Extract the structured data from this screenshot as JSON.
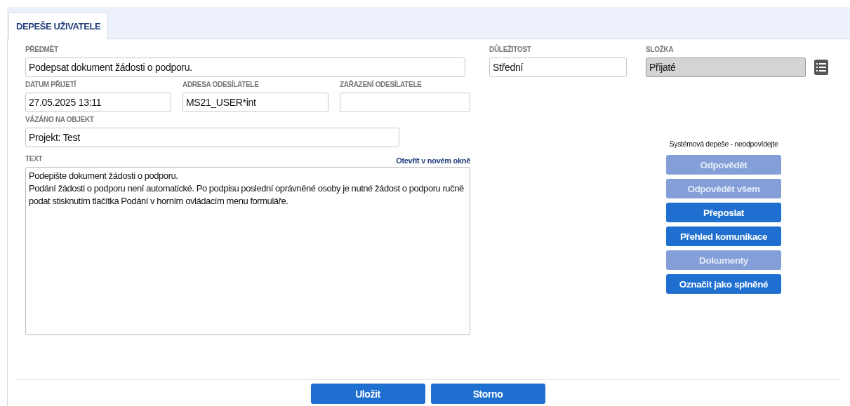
{
  "tab": {
    "label": "DEPEŠE UŽIVATELE",
    "selected": true
  },
  "subject": {
    "label": "PŘEDMĚT",
    "value": "Podepsat dokument žádosti o podporu."
  },
  "importance": {
    "label": "DŮLEŽITOST",
    "value": "Střední"
  },
  "folder": {
    "label": "SLOŽKA",
    "value": "Přijaté",
    "disabled": true
  },
  "received": {
    "label": "DATUM PŘIJETÍ",
    "value": "27.05.2025 13:11"
  },
  "sender_address": {
    "label": "ADRESA ODESÍLATELE",
    "value": "MS21_USER*int"
  },
  "sender_category": {
    "label": "ZAŘAZENÍ ODESÍLATELE"
  },
  "linked_object": {
    "label": "VÁZÁNO NA OBJEKT",
    "value": "Projekt: Test"
  },
  "text": {
    "label": "TEXT",
    "link": "Otevřít v novém okně",
    "lines": [
      "Podepište dokument žádosti o podporu.",
      "Podání žádosti o podporu není automatické. Po podpisu poslední oprávněné osoby je nutné žádost o podporu ručně podat stisknutím tlačítka Podání v horním ovládacím menu formuláře."
    ]
  },
  "system_note": "Systémová depeše - neodpovídejte",
  "actions": [
    {
      "label": "Odpovědět",
      "disabled": true
    },
    {
      "label": "Odpovědět všem",
      "disabled": true
    },
    {
      "label": "Přeposlat",
      "disabled": false
    },
    {
      "label": "Přehled komunikace",
      "disabled": false
    },
    {
      "label": "Dokumenty",
      "disabled": true
    },
    {
      "label": "Označit jako splněné",
      "disabled": false
    }
  ],
  "footer_buttons": [
    "Uložit",
    "Storno"
  ]
}
